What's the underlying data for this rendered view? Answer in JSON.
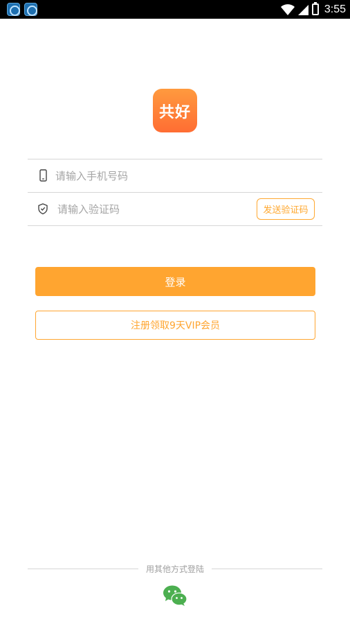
{
  "status_bar": {
    "time": "3:55",
    "notification_icons": [
      "app-notification-icon",
      "app-notification-icon"
    ],
    "system_icons": [
      "wifi-icon",
      "cell-signal-icon",
      "battery-charging-icon"
    ]
  },
  "logo": {
    "text": "共好"
  },
  "form": {
    "phone": {
      "placeholder": "请输入手机号码",
      "value": "",
      "icon": "phone-icon"
    },
    "code": {
      "placeholder": "请输入验证码",
      "value": "",
      "icon": "shield-icon"
    },
    "send_code_label": "发送验证码"
  },
  "buttons": {
    "login_label": "登录",
    "register_label": "注册领取9天VIP会员"
  },
  "other_login": {
    "label": "用其他方式登陆",
    "providers": [
      "wechat-icon"
    ]
  },
  "colors": {
    "accent": "#ffa530",
    "logo_gradient_top": "#ff9a3e",
    "logo_gradient_bottom": "#ff6d33",
    "wechat_green": "#4caf50"
  }
}
